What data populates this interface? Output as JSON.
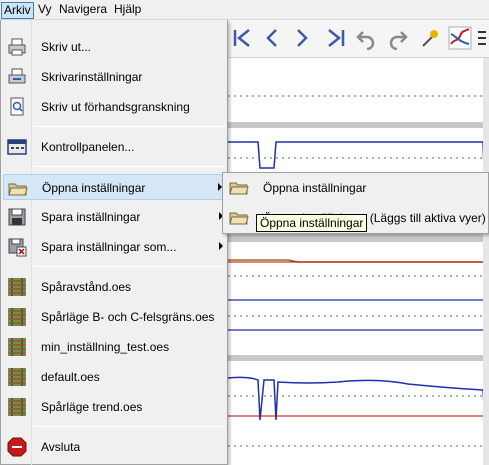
{
  "menubar": {
    "items": [
      {
        "label": "Arkiv",
        "active": true
      },
      {
        "label": "Vy",
        "active": false
      },
      {
        "label": "Navigera",
        "active": false
      },
      {
        "label": "Hjälp",
        "active": false
      }
    ]
  },
  "file_menu": {
    "print": "Skriv ut...",
    "printer_settings": "Skrivarinställningar",
    "print_preview": "Skriv ut förhandsgranskning",
    "control_panel": "Kontrollpanelen...",
    "open_settings": "Öppna inställningar",
    "save_settings": "Spara inställningar",
    "save_settings_as": "Spara inställningar som...",
    "recent_files": [
      "Spåravstånd.oes",
      "Spårläge B- och C-felsgräns.oes",
      "min_inställning_test.oes",
      "default.oes",
      "Spårläge trend.oes"
    ],
    "exit": "Avsluta"
  },
  "submenu": {
    "open_settings": "Öppna inställningar",
    "open_settings_append": "Öppna inställningar (Läggs till aktiva vyer)"
  },
  "tooltip": {
    "text": "Öppna inställningar"
  },
  "toolbar_icons": [
    "first-icon",
    "previous-icon",
    "next-icon",
    "last-icon",
    "undo-icon",
    "redo-icon",
    "pick-icon",
    "map-icon",
    "extra-icon"
  ],
  "colors": {
    "menu_bg": "#f0f0f0",
    "highlight": "#d5e6f7",
    "trace_blue": "#1f2fb0",
    "limit_red": "#c00000",
    "limit_green": "#2e8b2e"
  }
}
